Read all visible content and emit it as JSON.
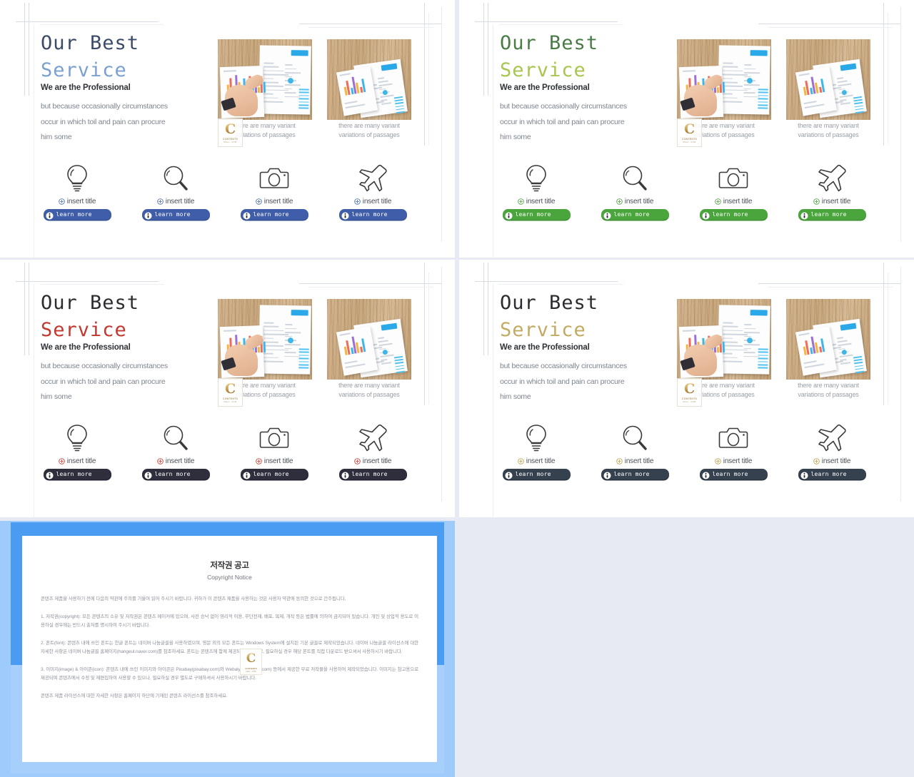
{
  "slides": [
    {
      "id": "slide-blue",
      "theme": {
        "title_dark": "#3b4a66",
        "title_accent": "#7aa0d2",
        "plus": "#4b6fa8",
        "button_bg": "#3f5da8",
        "button_shadow": "#35508f"
      },
      "title_line1": "Our Best",
      "title_line2": "Service",
      "lead": "We are the Professional",
      "body": [
        "but because occasionally circumstances",
        "occur in which toil and pain can procure",
        "him some"
      ],
      "captions": [
        [
          "there are many variant",
          "variations of passages"
        ],
        [
          "there are many variant",
          "variations of passages"
        ]
      ],
      "features": [
        {
          "icon": "lightbulb-icon",
          "title": "insert title",
          "button": "learn more"
        },
        {
          "icon": "magnifier-icon",
          "title": "insert title",
          "button": "learn more"
        },
        {
          "icon": "camera-icon",
          "title": "insert title",
          "button": "learn more"
        },
        {
          "icon": "airplane-icon",
          "title": "insert title",
          "button": "learn more"
        }
      ]
    },
    {
      "id": "slide-green",
      "theme": {
        "title_dark": "#4a7a46",
        "title_accent": "#a8c64f",
        "plus": "#4ea23f",
        "button_bg": "#4aa53c",
        "button_shadow": "#3e8c32"
      },
      "title_line1": "Our Best",
      "title_line2": "Service",
      "lead": "We are the Professional",
      "body": [
        "but because occasionally circumstances",
        "occur in which toil and pain can procure",
        "him some"
      ],
      "captions": [
        [
          "there are many variant",
          "variations of passages"
        ],
        [
          "there are many variant",
          "variations of passages"
        ]
      ],
      "features": [
        {
          "icon": "lightbulb-icon",
          "title": "insert title",
          "button": "learn more"
        },
        {
          "icon": "magnifier-icon",
          "title": "insert title",
          "button": "learn more"
        },
        {
          "icon": "camera-icon",
          "title": "insert title",
          "button": "learn more"
        },
        {
          "icon": "airplane-icon",
          "title": "insert title",
          "button": "learn more"
        }
      ]
    },
    {
      "id": "slide-red",
      "theme": {
        "title_dark": "#2b2b30",
        "title_accent": "#c0392f",
        "plus": "#cf3a30",
        "button_bg": "#2e2e3d",
        "button_shadow": "#212130"
      },
      "title_line1": "Our Best",
      "title_line2": "Service",
      "lead": "We are the Professional",
      "body": [
        "but because occasionally circumstances",
        "occur in which toil and pain can procure",
        "him some"
      ],
      "captions": [
        [
          "there are many variant",
          "variations of passages"
        ],
        [
          "there are many variant",
          "variations of passages"
        ]
      ],
      "features": [
        {
          "icon": "lightbulb-icon",
          "title": "insert title",
          "button": "learn more"
        },
        {
          "icon": "magnifier-icon",
          "title": "insert title",
          "button": "learn more"
        },
        {
          "icon": "camera-icon",
          "title": "insert title",
          "button": "learn more"
        },
        {
          "icon": "airplane-icon",
          "title": "insert title",
          "button": "learn more"
        }
      ]
    },
    {
      "id": "slide-gold",
      "theme": {
        "title_dark": "#2b2b30",
        "title_accent": "#c3aa63",
        "plus": "#c3a14a",
        "button_bg": "#35414f",
        "button_shadow": "#28323d"
      },
      "title_line1": "Our Best",
      "title_line2": "Service",
      "lead": "We are the Professional",
      "body": [
        "but because occasionally circumstances",
        "occur in which toil and pain can procure",
        "him some"
      ],
      "captions": [
        [
          "there are many variant",
          "variations of passages"
        ],
        [
          "there are many variant",
          "variations of passages"
        ]
      ],
      "features": [
        {
          "icon": "lightbulb-icon",
          "title": "insert title",
          "button": "learn more"
        },
        {
          "icon": "magnifier-icon",
          "title": "insert title",
          "button": "learn more"
        },
        {
          "icon": "camera-icon",
          "title": "insert title",
          "button": "learn more"
        },
        {
          "icon": "airplane-icon",
          "title": "insert title",
          "button": "learn more"
        }
      ]
    }
  ],
  "watermark": {
    "letter": "C",
    "line1": "CONTENTS",
    "line2": "MALL . COM"
  },
  "copyright": {
    "title": "저작권 공고",
    "subtitle": "Copyright Notice",
    "intro": "콘텐츠 제품을 사용하기 전에 다음의 약관에 주의를 기울여 읽어 주시기 바랍니다. 귀하가 이 콘텐츠 제품을 사용하는 것은 사용자 약관에 동의한 것으로 간주됩니다.",
    "items": [
      "1. 저작권(copyright): 모든 콘텐츠의 소유 및 저작권은 콘텐츠 메이커에 있으며, 사전 승낙 없이 영리적 이용, 무단전재, 배포, 복제, 개작 등은 법률에 의하여 금지되어 있습니다. 개인 및 상업적 용도로 이용하실 경우에는 반드시 출처를 명시하여 주시기 바랍니다.",
      "2. 폰트(font): 콘텐츠 내에 쓰인 폰트는 한글 폰트는 네이버 나눔글꼴을 사용하였으며, 영문 외의 모든 폰트는 Windows System에 설치된 기본 글꼴로 제작되었습니다. 네이버 나눔글꼴 라이선스에 대한 자세한 사항은 네이버 나눔글꼴 홈페이지(hangeul.naver.com)를 참조하세요. 폰트는 콘텐츠에 함께 제공되지 않으므로, 필요하실 경우 해당 폰트를 직접 다운로드 받으셔서 사용하시기 바랍니다.",
      "3. 이미지(image) & 아이콘(icon): 콘텐츠 내에 쓰인 이미지와 아이콘은 Pixabay(pixabay.com)와 Webalys(webalys.com) 등에서 제공한 무료 저작물을 사용하여 제작되었습니다. 이미지는 참고용으로 제공되며 콘텐츠에서 수정 및 재편집하여 사용할 수 있으나, 필요하실 경우 별도로 구매하셔서 사용하시기 바랍니다.",
      "콘텐츠 제품 라이선스에 대한 자세한 사항은 홈페이지 하단에 기재된 콘텐츠 라이선스를 참조하세요."
    ]
  }
}
